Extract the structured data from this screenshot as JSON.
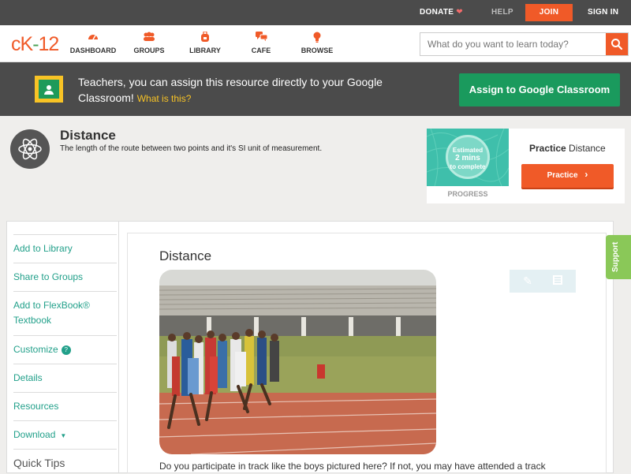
{
  "topbar": {
    "donate": "DONATE",
    "help": "HELP",
    "join": "JOIN",
    "signin": "SIGN IN"
  },
  "logo": {
    "ck": "cK",
    "dash": "-",
    "n": "12"
  },
  "nav": [
    {
      "label": "DASHBOARD",
      "icon": "speedometer-icon"
    },
    {
      "label": "GROUPS",
      "icon": "groups-icon"
    },
    {
      "label": "LIBRARY",
      "icon": "backpack-icon"
    },
    {
      "label": "CAFE",
      "icon": "chat-bubbles-icon"
    },
    {
      "label": "BROWSE",
      "icon": "lightbulb-icon"
    }
  ],
  "search": {
    "placeholder": "What do you want to learn today?"
  },
  "banner": {
    "text": "Teachers, you can assign this resource directly to your Google Classroom!",
    "what": "What is this?",
    "assign": "Assign to Google Classroom"
  },
  "concept": {
    "title": "Distance",
    "description": "The length of the route between two points and it's SI unit of measurement."
  },
  "practice": {
    "estimated_line1": "Estimated",
    "estimated_line2": "2 mins",
    "estimated_line3": "to complete",
    "progress": "PROGRESS",
    "title_bold": "Practice",
    "title_rest": "Distance",
    "button": "Practice"
  },
  "sidebar": {
    "items": [
      {
        "label": "Add to Library"
      },
      {
        "label": "Share to Groups"
      },
      {
        "label": "Add to FlexBook® Textbook"
      },
      {
        "label": "Customize"
      },
      {
        "label": "Details"
      },
      {
        "label": "Resources"
      },
      {
        "label": "Download"
      }
    ],
    "quick_tips": "Quick Tips"
  },
  "article": {
    "title": "Distance",
    "intro": "Do you participate in track like the boys pictured here? If not, you may have attended a track"
  },
  "support": "Support"
}
